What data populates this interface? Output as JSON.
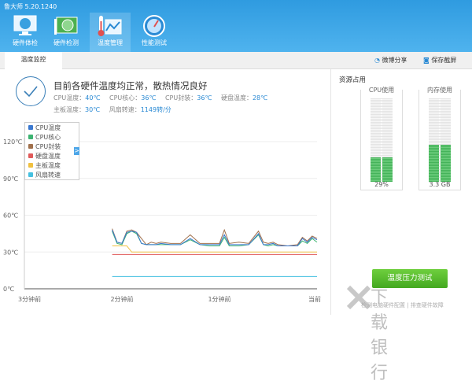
{
  "app": {
    "title": "鲁大师 5.20.1240"
  },
  "nav": [
    {
      "label": "硬件体检",
      "icon": "monitor-icon"
    },
    {
      "label": "硬件检测",
      "icon": "graphics-card-icon"
    },
    {
      "label": "温度管理",
      "icon": "thermometer-chart-icon",
      "active": true
    },
    {
      "label": "性能测试",
      "icon": "speedometer-icon"
    }
  ],
  "tabs": [
    {
      "label": "温度监控"
    }
  ],
  "toolbar": {
    "share": "微博分享",
    "screenshot": "保存截屏"
  },
  "status": {
    "headline": "目前各硬件温度均正常，散热情况良好",
    "items": [
      {
        "label": "CPU温度：",
        "value": "40℃"
      },
      {
        "label": "CPU核心：",
        "value": "36℃"
      },
      {
        "label": "CPU封装：",
        "value": "36℃"
      },
      {
        "label": "硬盘温度：",
        "value": "28℃"
      },
      {
        "label": "主板温度：",
        "value": "30℃"
      },
      {
        "label": "风扇转速：",
        "value": "1149转/分"
      }
    ]
  },
  "legend_toggle": ">",
  "resources": {
    "title": "资源占用",
    "cpu": {
      "label": "CPU使用",
      "value": "29%",
      "percent": 29
    },
    "memory": {
      "label": "内存使用",
      "value": "3.3 GB",
      "percent": 44
    }
  },
  "stress_button": "温度压力测试",
  "watermark": {
    "logo": "下载银行",
    "text": "检测电脑硬件配置 | 排查硬件故障"
  },
  "chart_data": {
    "type": "line",
    "yticks": [
      "0℃",
      "30℃",
      "60℃",
      "90℃",
      "120℃"
    ],
    "ylim": [
      0,
      120
    ],
    "xticks": [
      "3分钟前",
      "2分钟前",
      "1分钟前",
      "当前"
    ],
    "xlim": [
      -3,
      0
    ],
    "grid": "horizontal",
    "legend_placement": "top-left",
    "x": [
      -2.1,
      -2.05,
      -2.0,
      -1.95,
      -1.9,
      -1.85,
      -1.8,
      -1.75,
      -1.7,
      -1.65,
      -1.6,
      -1.5,
      -1.4,
      -1.3,
      -1.2,
      -1.1,
      -1.0,
      -0.95,
      -0.9,
      -0.8,
      -0.7,
      -0.6,
      -0.55,
      -0.5,
      -0.45,
      -0.4,
      -0.3,
      -0.2,
      -0.15,
      -0.1,
      -0.05,
      0
    ],
    "series": [
      {
        "name": "CPU温度",
        "color": "#3a78d0",
        "values": [
          48,
          38,
          37,
          46,
          47,
          46,
          37,
          36,
          36,
          36,
          37,
          36,
          36,
          41,
          36,
          36,
          36,
          44,
          36,
          36,
          36,
          45,
          36,
          36,
          37,
          35,
          35,
          35,
          41,
          38,
          42,
          40
        ]
      },
      {
        "name": "CPU核心",
        "color": "#3cb371",
        "values": [
          47,
          37,
          36,
          45,
          47,
          45,
          37,
          36,
          36,
          36,
          36,
          36,
          36,
          40,
          36,
          35,
          35,
          42,
          35,
          35,
          36,
          44,
          36,
          35,
          36,
          35,
          35,
          35,
          39,
          37,
          41,
          38
        ]
      },
      {
        "name": "CPU封装",
        "color": "#a0704c",
        "values": [
          49,
          38,
          37,
          47,
          48,
          46,
          41,
          36,
          38,
          37,
          38,
          37,
          37,
          44,
          37,
          37,
          37,
          48,
          37,
          38,
          37,
          47,
          38,
          37,
          38,
          36,
          35,
          36,
          42,
          39,
          43,
          41
        ]
      },
      {
        "name": "硬盘温度",
        "color": "#e05a5a",
        "values": [
          28,
          28,
          28,
          28,
          28,
          28,
          28,
          28,
          28,
          28,
          28,
          28,
          28,
          28,
          28,
          28,
          28,
          28,
          28,
          28,
          28,
          28,
          28,
          28,
          28,
          28,
          28,
          28,
          28,
          28,
          28,
          28
        ]
      },
      {
        "name": "主板温度",
        "color": "#f0c040",
        "values": [
          35,
          35,
          35,
          35,
          30,
          30,
          30,
          30,
          30,
          30,
          30,
          30,
          30,
          30,
          30,
          30,
          30,
          30,
          30,
          30,
          30,
          30,
          30,
          30,
          30,
          30,
          30,
          30,
          30,
          30,
          30,
          30
        ]
      },
      {
        "name": "风扇转速",
        "color": "#45c0e0",
        "values": [
          10,
          10,
          10,
          10,
          10,
          10,
          10,
          10,
          10,
          10,
          10,
          10,
          10,
          10,
          10,
          10,
          10,
          10,
          10,
          10,
          10,
          10,
          10,
          10,
          10,
          10,
          10,
          10,
          10,
          10,
          10,
          10
        ]
      }
    ]
  }
}
